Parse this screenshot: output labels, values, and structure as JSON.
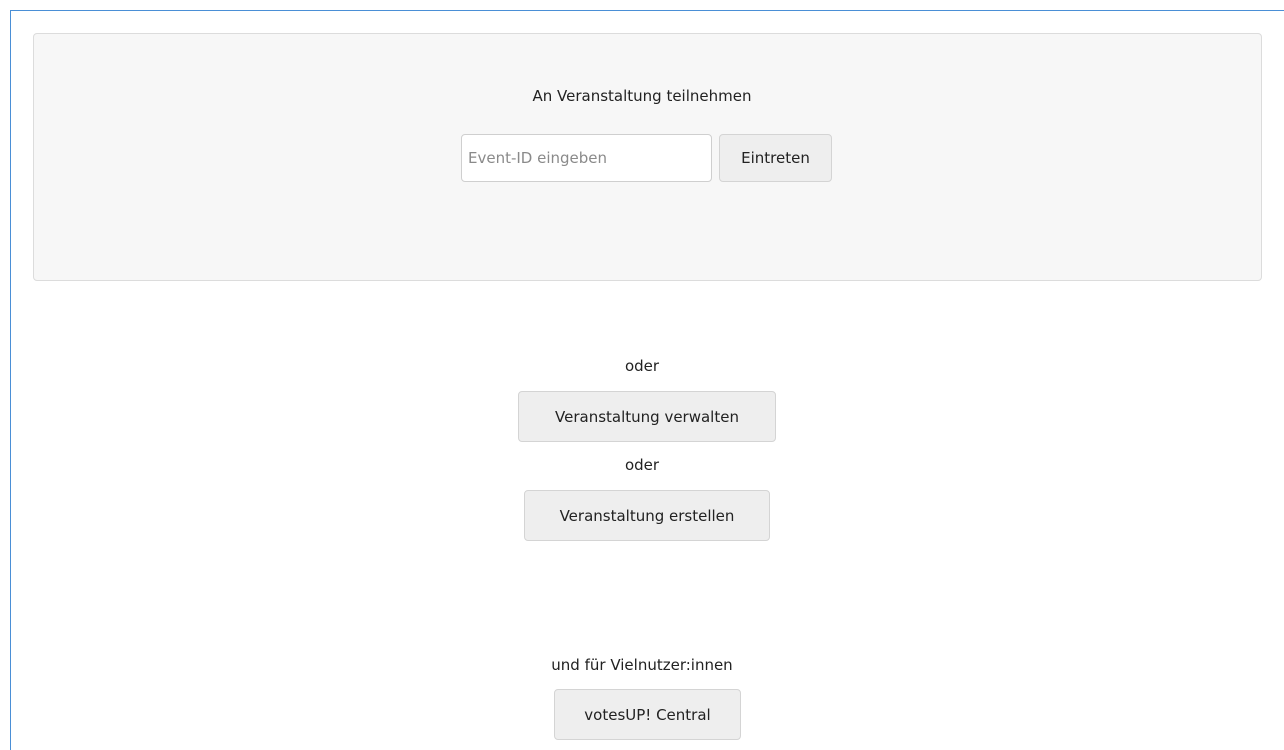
{
  "join": {
    "title": "An Veranstaltung teilnehmen",
    "input_placeholder": "Event-ID eingeben",
    "input_value": "",
    "enter_label": "Eintreten"
  },
  "separator_1": "oder",
  "manage_label": "Veranstaltung verwalten",
  "separator_2": "oder",
  "create_label": "Veranstaltung erstellen",
  "power_users_text": "und für Vielnutzer:innen",
  "central_label": "votesUP! Central"
}
